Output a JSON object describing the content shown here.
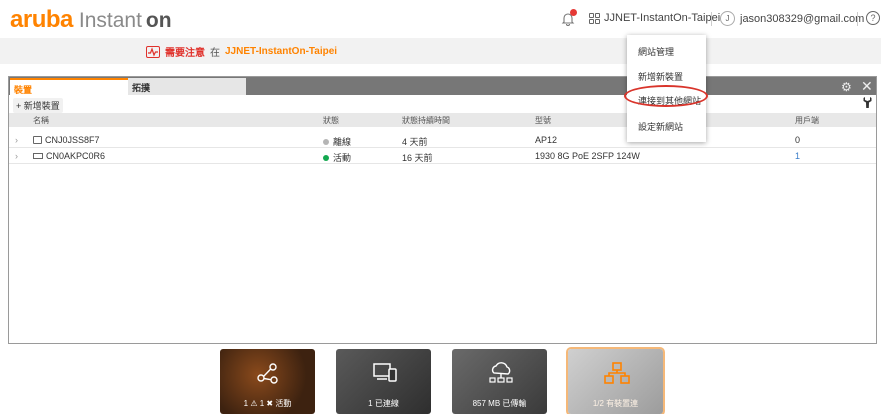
{
  "header": {
    "logo_brand": "aruba",
    "logo_product": "Instant",
    "logo_on": "on",
    "site_name": "JJNET-InstantOn-Taipei",
    "account_initial": "J",
    "account_email": "jason308329@gmail.com",
    "help_glyph": "?"
  },
  "alert": {
    "label": "需要注意",
    "in_text": "在",
    "site": "JJNET-InstantOn-Taipei"
  },
  "tabs": [
    {
      "label": "裝置",
      "active": true
    },
    {
      "label": "拓撲",
      "active": false
    }
  ],
  "toolbar": {
    "add_label": "+ 新增裝置",
    "gear_glyph": "⚙",
    "close_glyph": "✕",
    "wrench_glyph": "🔧"
  },
  "table": {
    "columns": [
      "名稱",
      "狀態",
      "狀態持續時間",
      "型號",
      "用戶端"
    ],
    "rows": [
      {
        "name": "CNJ0JSS8F7",
        "device": "ap",
        "status": "離線",
        "status_color": "#b5b5b5",
        "duration": "4 天前",
        "model": "AP12",
        "clients": "0"
      },
      {
        "name": "CN0AKPC0R6",
        "device": "switch",
        "status": "活動",
        "status_color": "#13a84f",
        "duration": "16 天前",
        "model": "1930 8G PoE 2SFP 124W",
        "clients": "1"
      }
    ]
  },
  "menu": {
    "items": [
      "網站管理",
      "新增新裝置",
      "連接到其他網站",
      "設定新網站"
    ],
    "highlighted_index": 2,
    "highlight_color": "#d9342b"
  },
  "tiles": [
    {
      "label": "1 ⚠  1 ✖  活動",
      "icon": "network-topology-icon",
      "bg": "#5a3418"
    },
    {
      "label": "1 已連線",
      "icon": "devices-icon",
      "bg": "#3c3c3c"
    },
    {
      "label": "857 MB 已傳輸",
      "icon": "cloud-network-icon",
      "bg": "#4a4a4a"
    },
    {
      "label": "1/2 有裝置連",
      "icon": "network-hierarchy-icon",
      "bg": "#a9a9a9"
    }
  ],
  "colors": {
    "accent": "#ff8300",
    "alert": "#e0312b",
    "online": "#13a84f",
    "offline": "#b5b5b5",
    "client_link": "#3a7dc9"
  }
}
